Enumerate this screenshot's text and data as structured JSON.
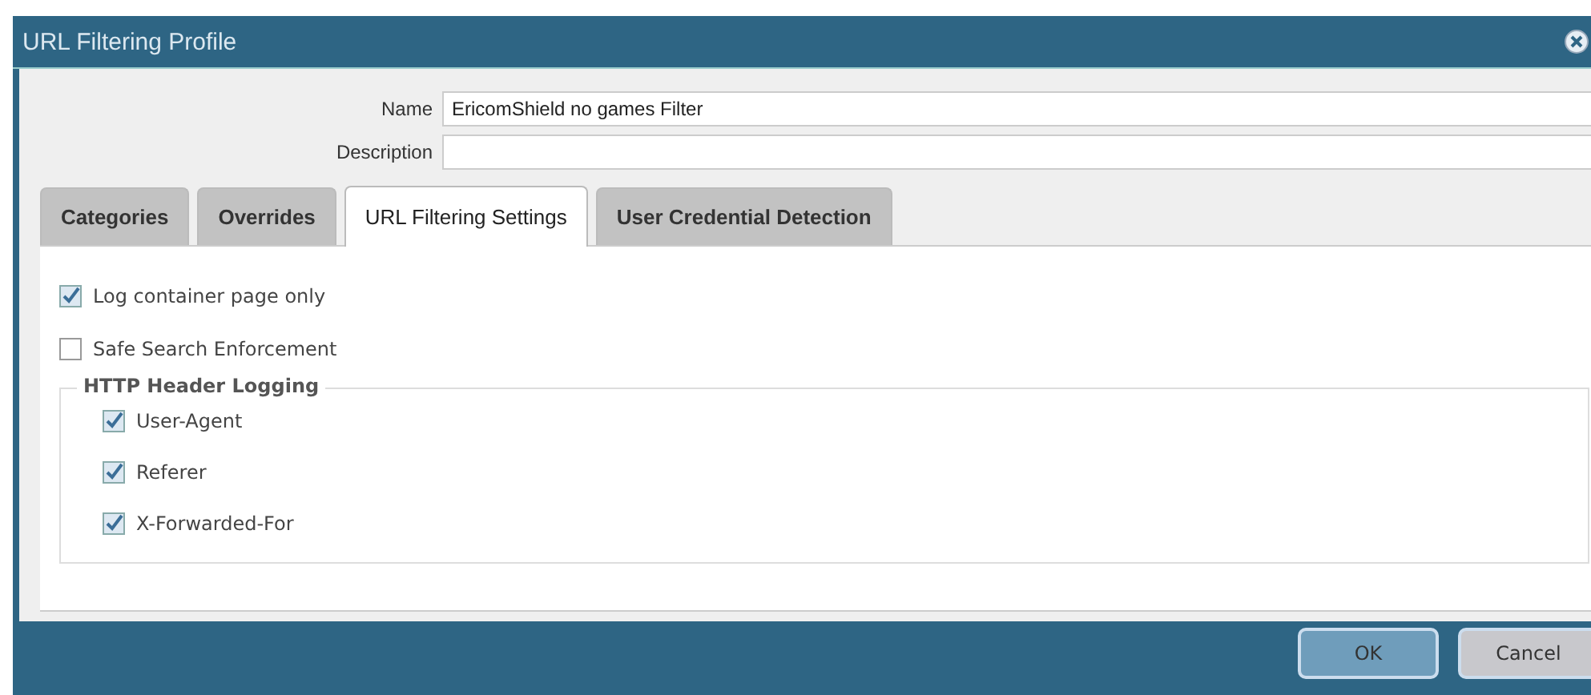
{
  "window": {
    "title": "URL Filtering Profile"
  },
  "fields": [
    {
      "label": "Name",
      "value": "EricomShield no games Filter"
    },
    {
      "label": "Description"
    }
  ],
  "tabs": [
    {
      "label": "Categories",
      "selected": false
    },
    {
      "label": "Overrides",
      "selected": false
    },
    {
      "label": "URL Filtering Settings",
      "selected": true
    },
    {
      "label": "User Credential Detection",
      "selected": false
    }
  ],
  "options": [
    {
      "label": "Log container page only",
      "checked": true
    },
    {
      "label": "Safe Search Enforcement",
      "checked": false
    }
  ],
  "http_header_logging": {
    "title": "HTTP Header Logging",
    "items": [
      {
        "label": "User-Agent",
        "checked": true
      },
      {
        "label": "Referer",
        "checked": true
      },
      {
        "label": "X-Forwarded-For",
        "checked": true
      }
    ]
  },
  "buttons": [
    {
      "label": "OK",
      "kind": "primary"
    },
    {
      "label": "Cancel",
      "kind": "secondary"
    }
  ]
}
